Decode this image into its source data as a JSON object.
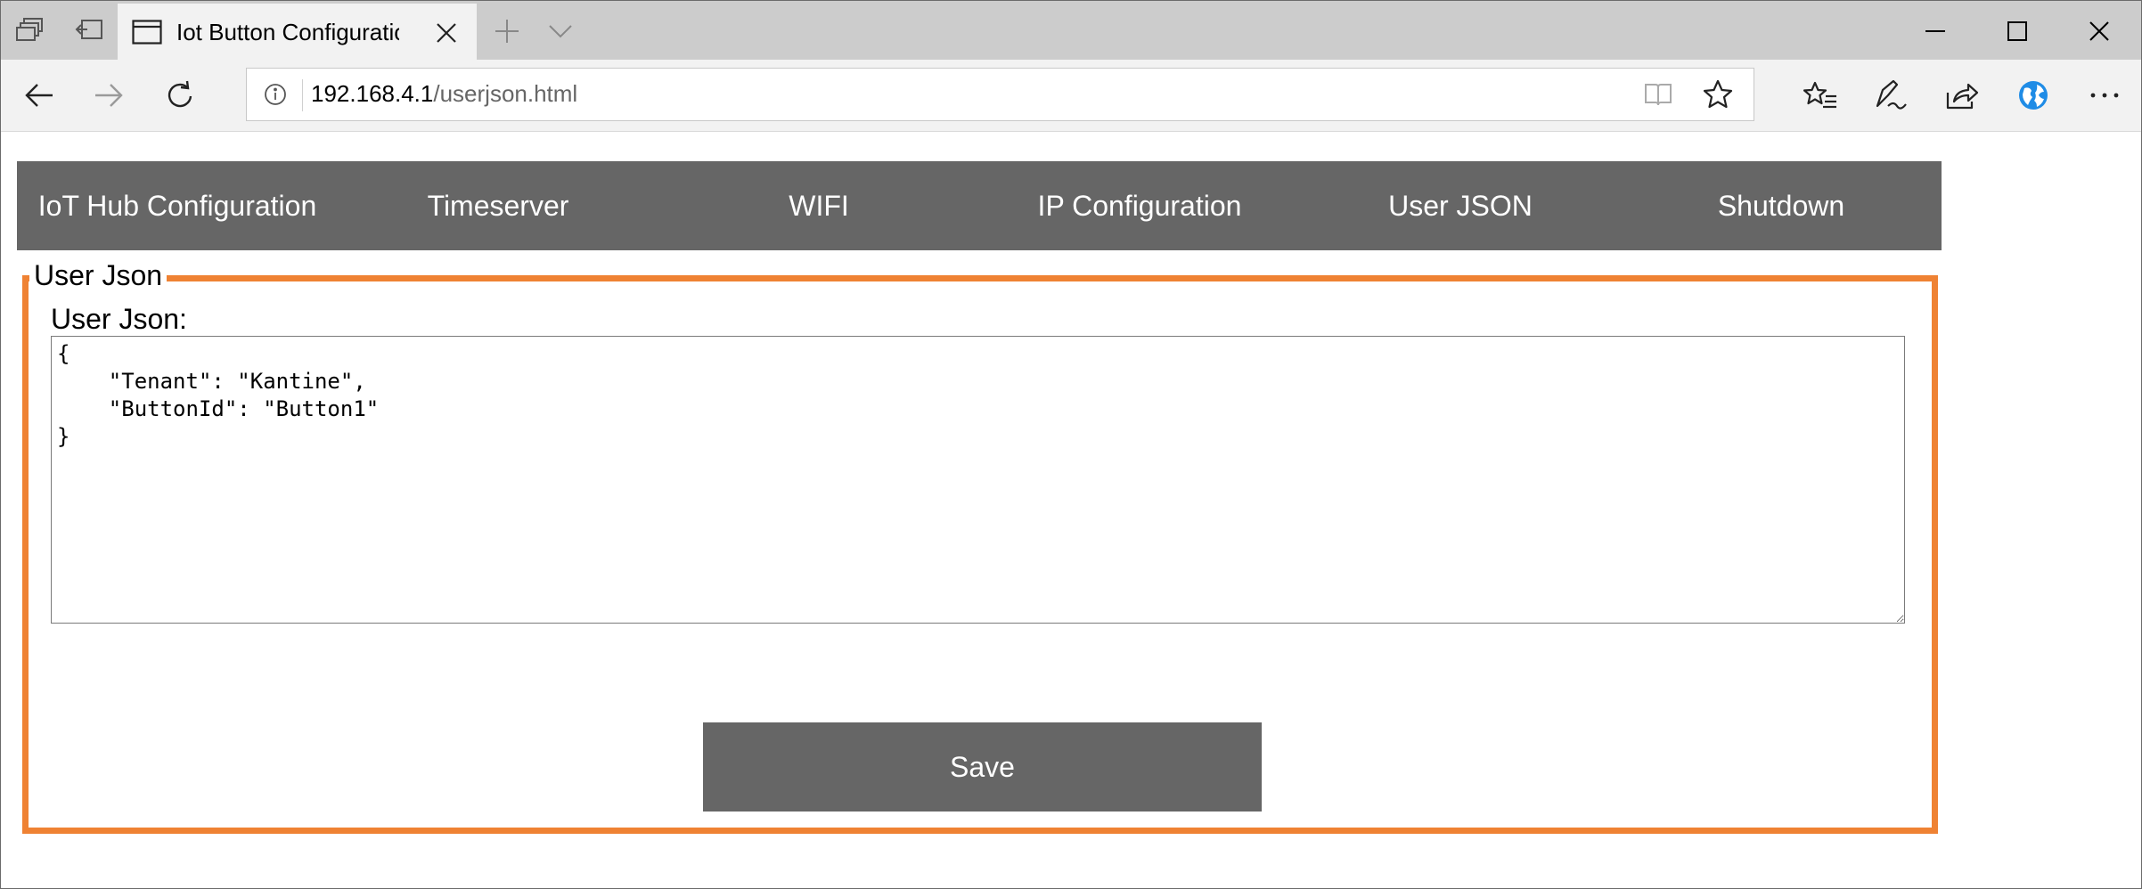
{
  "browser": {
    "tab_title": "Iot Button Configuratio",
    "address": {
      "host": "192.168.4.1",
      "path": "/userjson.html"
    }
  },
  "nav": {
    "items": [
      {
        "label": "IoT Hub Configuration"
      },
      {
        "label": "Timeserver"
      },
      {
        "label": "WIFI"
      },
      {
        "label": "IP Configuration"
      },
      {
        "label": "User JSON"
      },
      {
        "label": "Shutdown"
      }
    ]
  },
  "form": {
    "legend": "User Json",
    "field_label": "User Json:",
    "json_value": "{\n    \"Tenant\": \"Kantine\",\n    \"ButtonId\": \"Button1\"\n}",
    "save_label": "Save"
  },
  "colors": {
    "accent": "#ef8233",
    "nav_background": "#666666",
    "nav_text": "#ffffff"
  },
  "icons": {
    "titlebar": [
      "tab-set-aside-icon",
      "tabs-aside-icon",
      "page-icon",
      "close-icon",
      "plus-icon",
      "chevron-down-icon",
      "minimize-icon",
      "maximize-icon",
      "window-close-icon"
    ],
    "toolbar": [
      "back-arrow-icon",
      "forward-arrow-icon",
      "refresh-icon",
      "info-icon",
      "reading-view-icon",
      "favorite-star-icon",
      "favorites-list-icon",
      "pen-icon",
      "share-icon",
      "profile-icon",
      "more-icon"
    ]
  }
}
